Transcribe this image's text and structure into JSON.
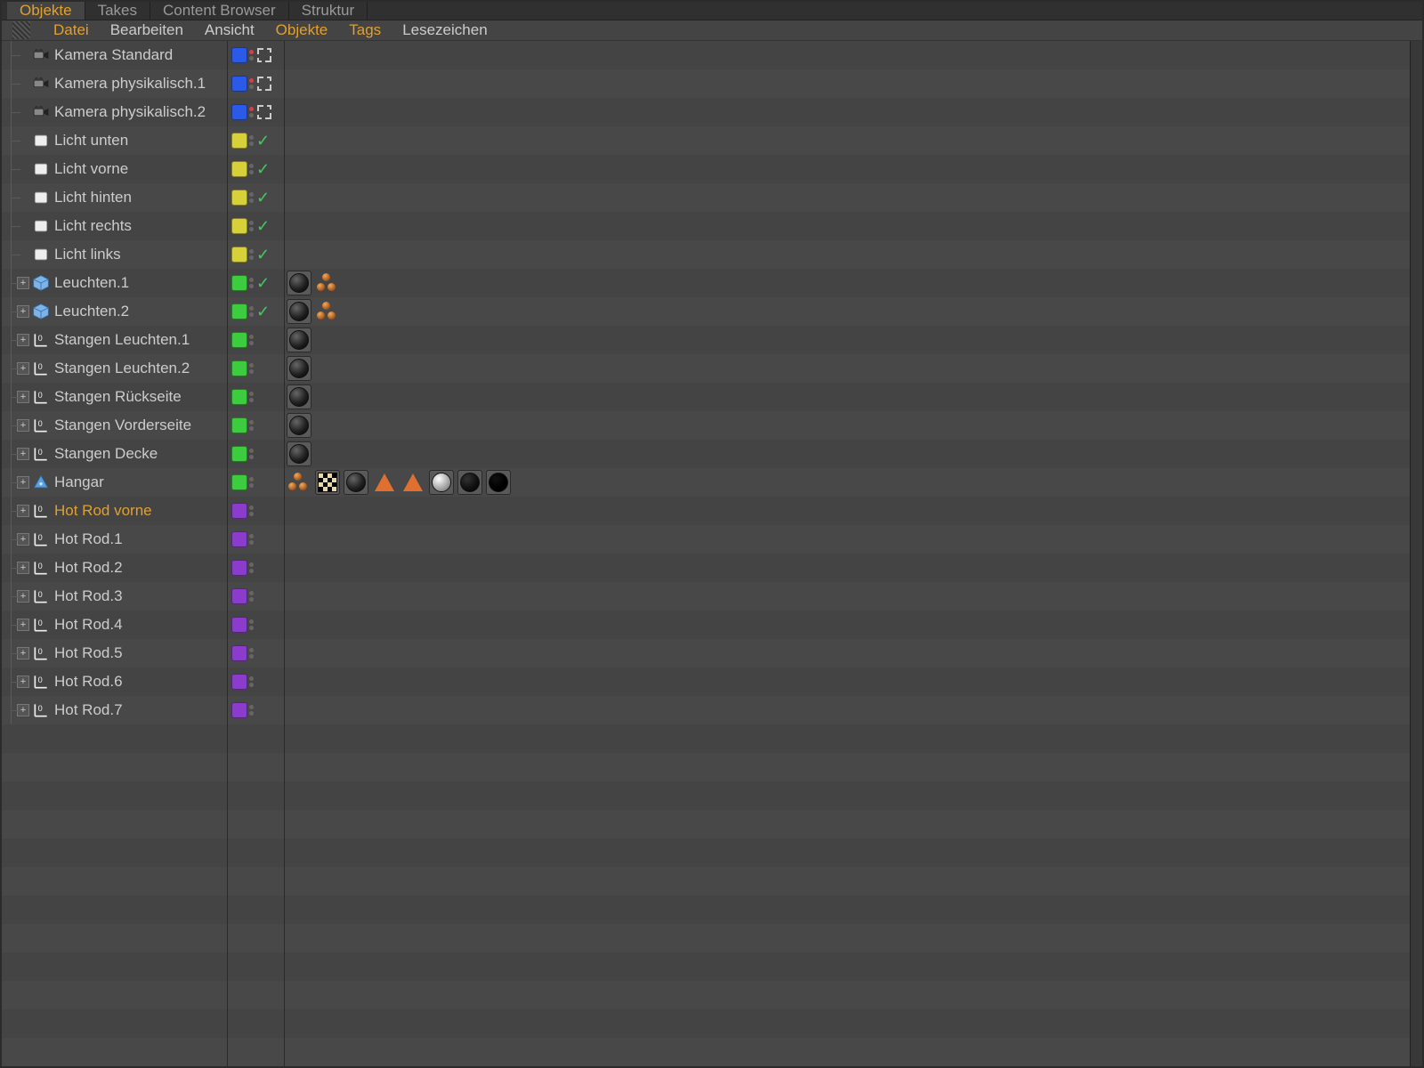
{
  "tabs": [
    {
      "label": "Objekte",
      "active": true
    },
    {
      "label": "Takes",
      "active": false
    },
    {
      "label": "Content Browser",
      "active": false
    },
    {
      "label": "Struktur",
      "active": false
    }
  ],
  "menu": [
    {
      "label": "Datei",
      "highlight": true
    },
    {
      "label": "Bearbeiten",
      "highlight": false
    },
    {
      "label": "Ansicht",
      "highlight": false
    },
    {
      "label": "Objekte",
      "highlight": true
    },
    {
      "label": "Tags",
      "highlight": true
    },
    {
      "label": "Lesezeichen",
      "highlight": false
    }
  ],
  "rows": [
    {
      "name": "Kamera Standard",
      "icon": "camera",
      "exp": null,
      "chip": "blue",
      "dots": "red",
      "mark": "corners",
      "tags": []
    },
    {
      "name": "Kamera physikalisch.1",
      "icon": "camera",
      "exp": null,
      "chip": "blue",
      "dots": "red",
      "mark": "corners",
      "tags": []
    },
    {
      "name": "Kamera physikalisch.2",
      "icon": "camera",
      "exp": null,
      "chip": "blue",
      "dots": "red",
      "mark": "corners",
      "tags": []
    },
    {
      "name": "Licht unten",
      "icon": "light",
      "exp": null,
      "chip": "yellow",
      "dots": "gray",
      "mark": "check",
      "tags": []
    },
    {
      "name": "Licht vorne",
      "icon": "light",
      "exp": null,
      "chip": "yellow",
      "dots": "gray",
      "mark": "check",
      "tags": []
    },
    {
      "name": "Licht hinten",
      "icon": "light",
      "exp": null,
      "chip": "yellow",
      "dots": "gray",
      "mark": "check",
      "tags": []
    },
    {
      "name": "Licht rechts",
      "icon": "light",
      "exp": null,
      "chip": "yellow",
      "dots": "gray",
      "mark": "check",
      "tags": []
    },
    {
      "name": "Licht links",
      "icon": "light",
      "exp": null,
      "chip": "yellow",
      "dots": "gray",
      "mark": "check",
      "tags": []
    },
    {
      "name": "Leuchten.1",
      "icon": "cube",
      "exp": "plus",
      "chip": "green",
      "dots": "gray",
      "mark": "check",
      "tags": [
        "sphere",
        "bronze"
      ]
    },
    {
      "name": "Leuchten.2",
      "icon": "cube",
      "exp": "plus",
      "chip": "green",
      "dots": "gray",
      "mark": "check",
      "tags": [
        "sphere",
        "bronze"
      ]
    },
    {
      "name": "Stangen Leuchten.1",
      "icon": "null",
      "exp": "plus",
      "chip": "green",
      "dots": "gray",
      "mark": "",
      "tags": [
        "sphere"
      ]
    },
    {
      "name": "Stangen Leuchten.2",
      "icon": "null",
      "exp": "plus",
      "chip": "green",
      "dots": "gray",
      "mark": "",
      "tags": [
        "sphere"
      ]
    },
    {
      "name": "Stangen Rückseite",
      "icon": "null",
      "exp": "plus",
      "chip": "green",
      "dots": "gray",
      "mark": "",
      "tags": [
        "sphere"
      ]
    },
    {
      "name": "Stangen Vorderseite",
      "icon": "null",
      "exp": "plus",
      "chip": "green",
      "dots": "gray",
      "mark": "",
      "tags": [
        "sphere"
      ]
    },
    {
      "name": "Stangen Decke",
      "icon": "null",
      "exp": "plus",
      "chip": "green",
      "dots": "gray",
      "mark": "",
      "tags": [
        "sphere"
      ]
    },
    {
      "name": "Hangar",
      "icon": "sky",
      "exp": "plus",
      "chip": "green",
      "dots": "gray",
      "mark": "",
      "tags": [
        "bronze",
        "checker",
        "sphere",
        "tri",
        "tri",
        "sphere-white",
        "sphere-black",
        "sphere-jetblack"
      ]
    },
    {
      "name": "Hot Rod vorne",
      "icon": "null",
      "exp": "plus",
      "chip": "purple",
      "dots": "gray",
      "mark": "",
      "tags": [],
      "selected": true
    },
    {
      "name": "Hot Rod.1",
      "icon": "null",
      "exp": "plus",
      "chip": "purple",
      "dots": "gray",
      "mark": "",
      "tags": []
    },
    {
      "name": "Hot Rod.2",
      "icon": "null",
      "exp": "plus",
      "chip": "purple",
      "dots": "gray",
      "mark": "",
      "tags": []
    },
    {
      "name": "Hot Rod.3",
      "icon": "null",
      "exp": "plus",
      "chip": "purple",
      "dots": "gray",
      "mark": "",
      "tags": []
    },
    {
      "name": "Hot Rod.4",
      "icon": "null",
      "exp": "plus",
      "chip": "purple",
      "dots": "gray",
      "mark": "",
      "tags": []
    },
    {
      "name": "Hot Rod.5",
      "icon": "null",
      "exp": "plus",
      "chip": "purple",
      "dots": "gray",
      "mark": "",
      "tags": []
    },
    {
      "name": "Hot Rod.6",
      "icon": "null",
      "exp": "plus",
      "chip": "purple",
      "dots": "gray",
      "mark": "",
      "tags": []
    },
    {
      "name": "Hot Rod.7",
      "icon": "null",
      "exp": "plus",
      "chip": "purple",
      "dots": "gray",
      "mark": "",
      "tags": []
    }
  ]
}
